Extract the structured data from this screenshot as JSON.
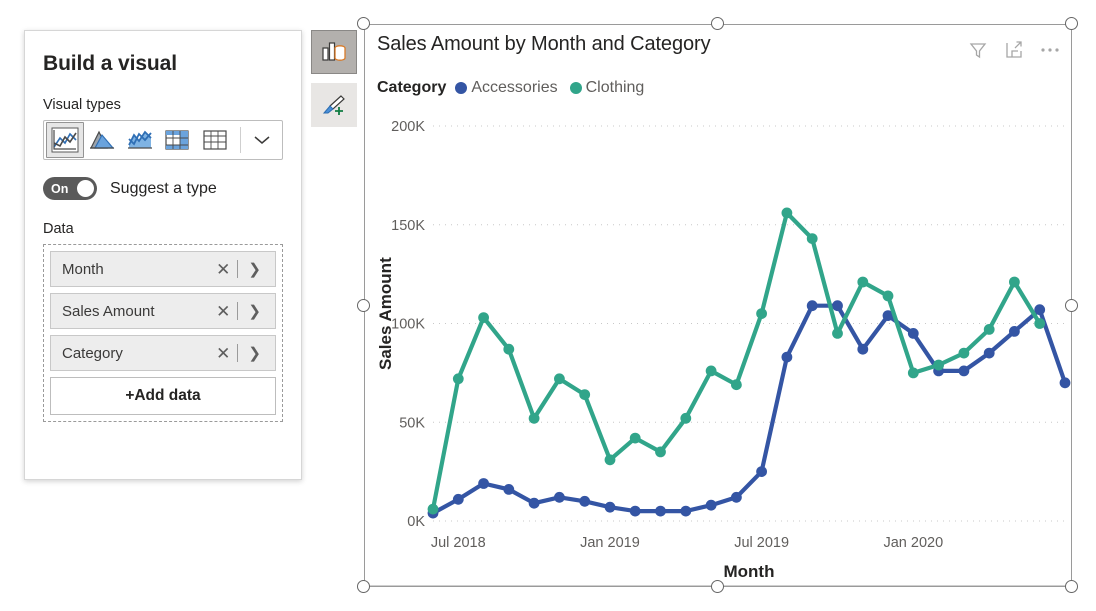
{
  "pane": {
    "title": "Build a visual",
    "visual_types_label": "Visual types",
    "data_label": "Data",
    "visual_type_icons": [
      "line-chart-icon",
      "area-chart-icon",
      "line-stacked-chart-icon",
      "matrix-table-icon",
      "table-icon"
    ],
    "expand_icon": "chevron-down-icon",
    "toggle": {
      "state": "On",
      "label": "Suggest a type"
    },
    "fields": [
      {
        "name": "Month",
        "remove_icon": "close-icon",
        "expand_icon": "chevron-right-icon"
      },
      {
        "name": "Sales Amount",
        "remove_icon": "close-icon",
        "expand_icon": "chevron-right-icon"
      },
      {
        "name": "Category",
        "remove_icon": "close-icon",
        "expand_icon": "chevron-right-icon"
      }
    ],
    "add_data_label": "+Add data"
  },
  "toolbar": {
    "build_visual": {
      "icon": "build-visual-icon",
      "state": "active"
    },
    "format_visual": {
      "icon": "format-paintbrush-icon",
      "state": "inactive"
    }
  },
  "visual": {
    "title": "Sales Amount by Month and Category",
    "header_icons": [
      "filter-icon",
      "focus-mode-icon",
      "more-options-icon"
    ],
    "legend": {
      "title": "Category",
      "items": [
        {
          "label": "Accessories",
          "color": "#3455A4"
        },
        {
          "label": "Clothing",
          "color": "#31A58A"
        }
      ]
    }
  },
  "chart_data": {
    "type": "line",
    "title": "Sales Amount by Month and Category",
    "xlabel": "Month",
    "ylabel": "Sales Amount",
    "ylim": [
      0,
      200000
    ],
    "ytick_labels": [
      "0K",
      "50K",
      "100K",
      "150K",
      "200K"
    ],
    "ytick_values": [
      0,
      50000,
      100000,
      150000,
      200000
    ],
    "xtick_labels": [
      "Jul 2018",
      "Jan 2019",
      "Jul 2019",
      "Jan 2020"
    ],
    "grid": "horizontal-dotted",
    "legend_position": "top-left",
    "markers": true,
    "x": [
      "Jun 2018",
      "Jul 2018",
      "Aug 2018",
      "Sep 2018",
      "Oct 2018",
      "Nov 2018",
      "Dec 2018",
      "Jan 2019",
      "Feb 2019",
      "Mar 2019",
      "Apr 2019",
      "May 2019",
      "Jun 2019",
      "Jul 2019",
      "Aug 2019",
      "Sep 2019",
      "Oct 2019",
      "Nov 2019",
      "Dec 2019",
      "Jan 2020",
      "Feb 2020",
      "Mar 2020",
      "Apr 2020"
    ],
    "series": [
      {
        "name": "Accessories",
        "color": "#3455A4",
        "values": [
          4000,
          11000,
          19000,
          16000,
          9000,
          12000,
          10000,
          7000,
          5000,
          5000,
          5000,
          8000,
          12000,
          25000,
          83000,
          109000,
          109000,
          87000,
          104000,
          95000,
          76000,
          76000,
          85000,
          96000,
          107000,
          70000
        ]
      },
      {
        "name": "Clothing",
        "color": "#31A58A",
        "values": [
          6000,
          72000,
          103000,
          87000,
          52000,
          72000,
          64000,
          31000,
          42000,
          35000,
          52000,
          76000,
          69000,
          105000,
          156000,
          143000,
          95000,
          121000,
          114000,
          75000,
          79000,
          85000,
          97000,
          121000,
          100000
        ]
      }
    ]
  }
}
